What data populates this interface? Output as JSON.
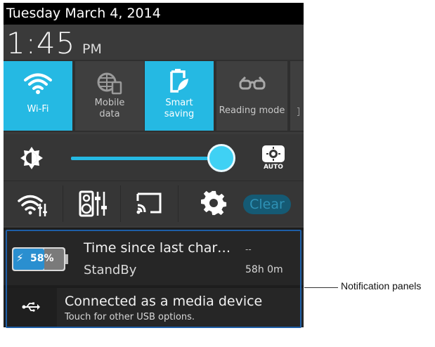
{
  "status_bar": {
    "date": "Tuesday March 4, 2014"
  },
  "clock": {
    "time": "1:45",
    "ampm": "PM"
  },
  "quick_tiles": [
    {
      "label": "Wi-Fi",
      "state": "on",
      "icon": "wifi-icon"
    },
    {
      "label": "Mobile\ndata",
      "state": "off",
      "icon": "globe-sim-icon"
    },
    {
      "label": "Smart\nsaving",
      "state": "on",
      "icon": "battery-leaf-icon"
    },
    {
      "label": "Reading mode",
      "state": "off",
      "icon": "glasses-icon"
    }
  ],
  "brightness": {
    "level_percent": 100,
    "auto_icon": "auto-brightness-icon",
    "auto_label": "AUTO"
  },
  "icon_row": {
    "items": [
      "wifi-settings-icon",
      "audio-equalizer-icon",
      "cast-screen-icon",
      "gear-icon"
    ],
    "clear_label": "Clear"
  },
  "notifications": [
    {
      "title": "Time since last char…",
      "subtitle": "StandBy",
      "right_top": "--",
      "right_bottom": "58h 0m",
      "battery_percent": "58%"
    },
    {
      "title": "Connected as a media device",
      "subtitle": "Touch for other USB options."
    }
  ],
  "callout": {
    "label": "Notification panels"
  },
  "colors": {
    "accent": "#25b9e3",
    "frame": "#1e5fa8",
    "panel_bg": "#262626"
  }
}
